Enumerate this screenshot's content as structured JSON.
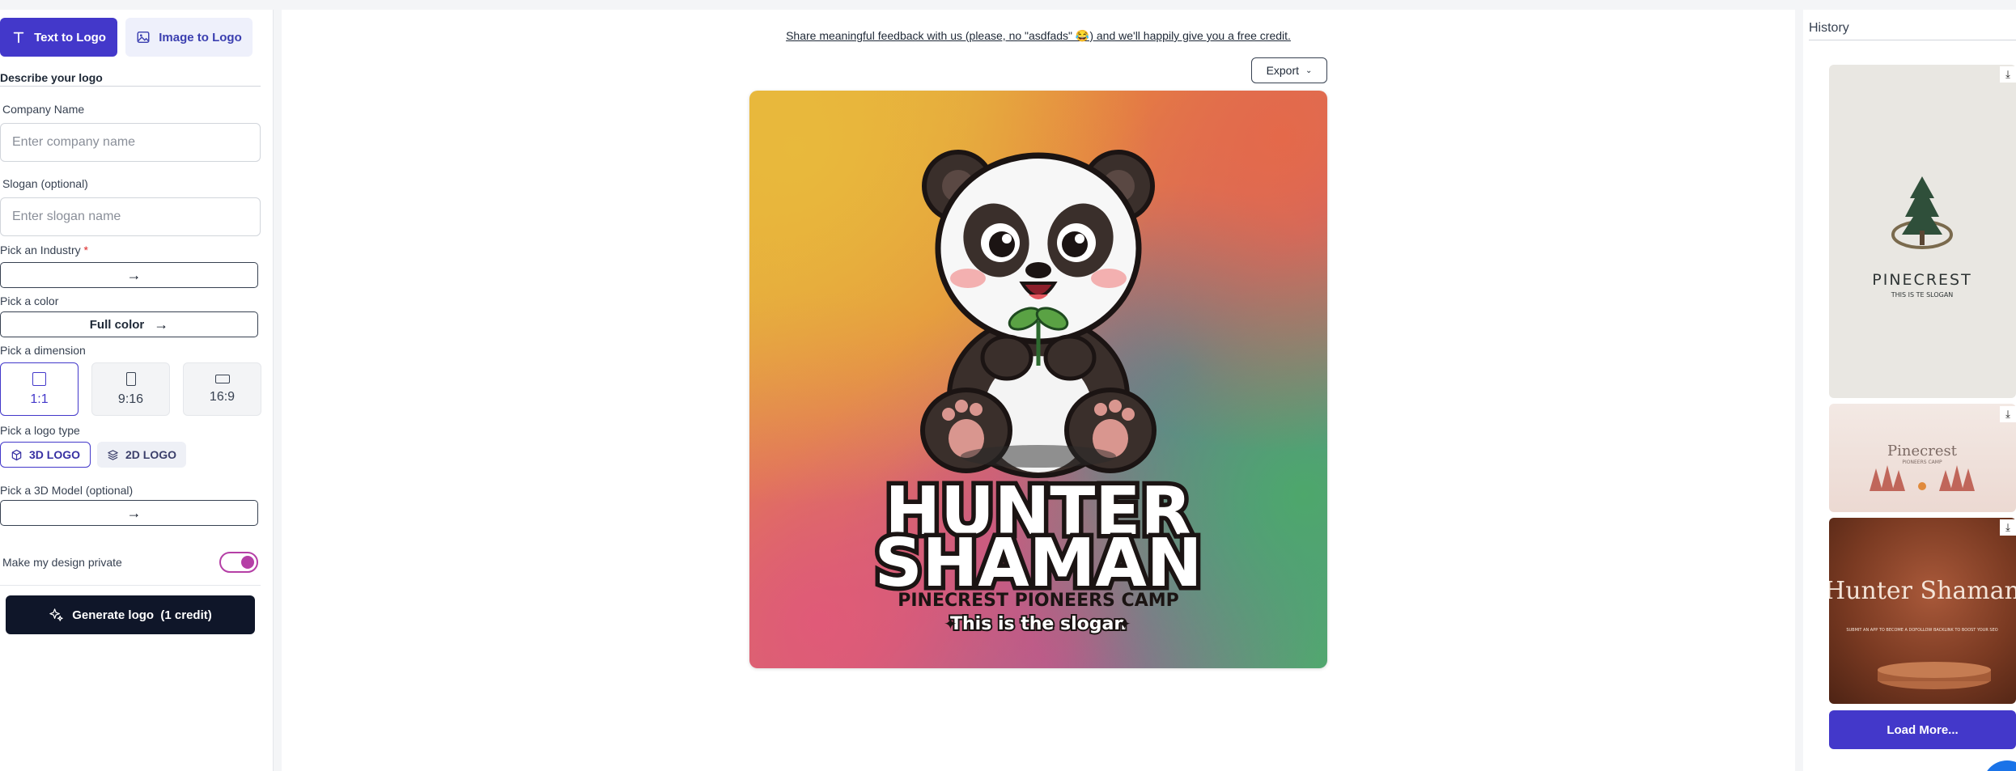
{
  "left_panel": {
    "tabs": [
      {
        "label": "Text to Logo",
        "active": true,
        "icon": "text-icon"
      },
      {
        "label": "Image to Logo",
        "active": false,
        "icon": "image-icon"
      }
    ],
    "section_title": "Describe your logo",
    "company_name": {
      "label": "Company Name",
      "placeholder": "Enter company name",
      "value": ""
    },
    "slogan": {
      "label": "Slogan (optional)",
      "placeholder": "Enter slogan name",
      "value": ""
    },
    "industry": {
      "label": "Pick an Industry",
      "required_mark": "*",
      "value": ""
    },
    "color": {
      "label": "Pick a color",
      "value": "Full color"
    },
    "dimension": {
      "label": "Pick a dimension",
      "options": [
        {
          "label": "1:1",
          "active": true
        },
        {
          "label": "9:16",
          "active": false
        },
        {
          "label": "16:9",
          "active": false
        }
      ]
    },
    "logo_type": {
      "label": "Pick a logo type",
      "options": [
        {
          "label": "3D LOGO",
          "active": true,
          "icon": "cube-icon"
        },
        {
          "label": "2D LOGO",
          "active": false,
          "icon": "layers-icon"
        }
      ]
    },
    "model": {
      "label": "Pick a 3D Model (optional)",
      "value": ""
    },
    "private_toggle": {
      "label": "Make my design private",
      "on": true
    },
    "generate_button": "Generate logo  (1 credit)"
  },
  "main": {
    "feedback_text": "Share meaningful feedback with us (please, no \"asdfads\" 😂) and we'll happily give you a free credit.",
    "export_label": "Export",
    "logo": {
      "title_line1": "HUNTER",
      "title_line2": "SHAMAN",
      "company": "PINECREST PIONEERS CAMP",
      "slogan": "This is the slogan"
    }
  },
  "history": {
    "title": "History",
    "items": [
      {
        "title": "PINECREST",
        "subtitle": "THIS IS TE SLOGAN"
      },
      {
        "title": "Pinecrest",
        "subtitle": "PIONEERS CAMP"
      },
      {
        "title": "Hunter Shaman",
        "subtitle": "SUBMIT AN APP TO BECOME A DOFOLLOW BACKLINK TO BOOST YOUR SEO"
      }
    ],
    "load_more": "Load More..."
  },
  "colors": {
    "primary": "#4338ca",
    "dark_button": "#0f1629",
    "toggle": "#b53fa6"
  }
}
